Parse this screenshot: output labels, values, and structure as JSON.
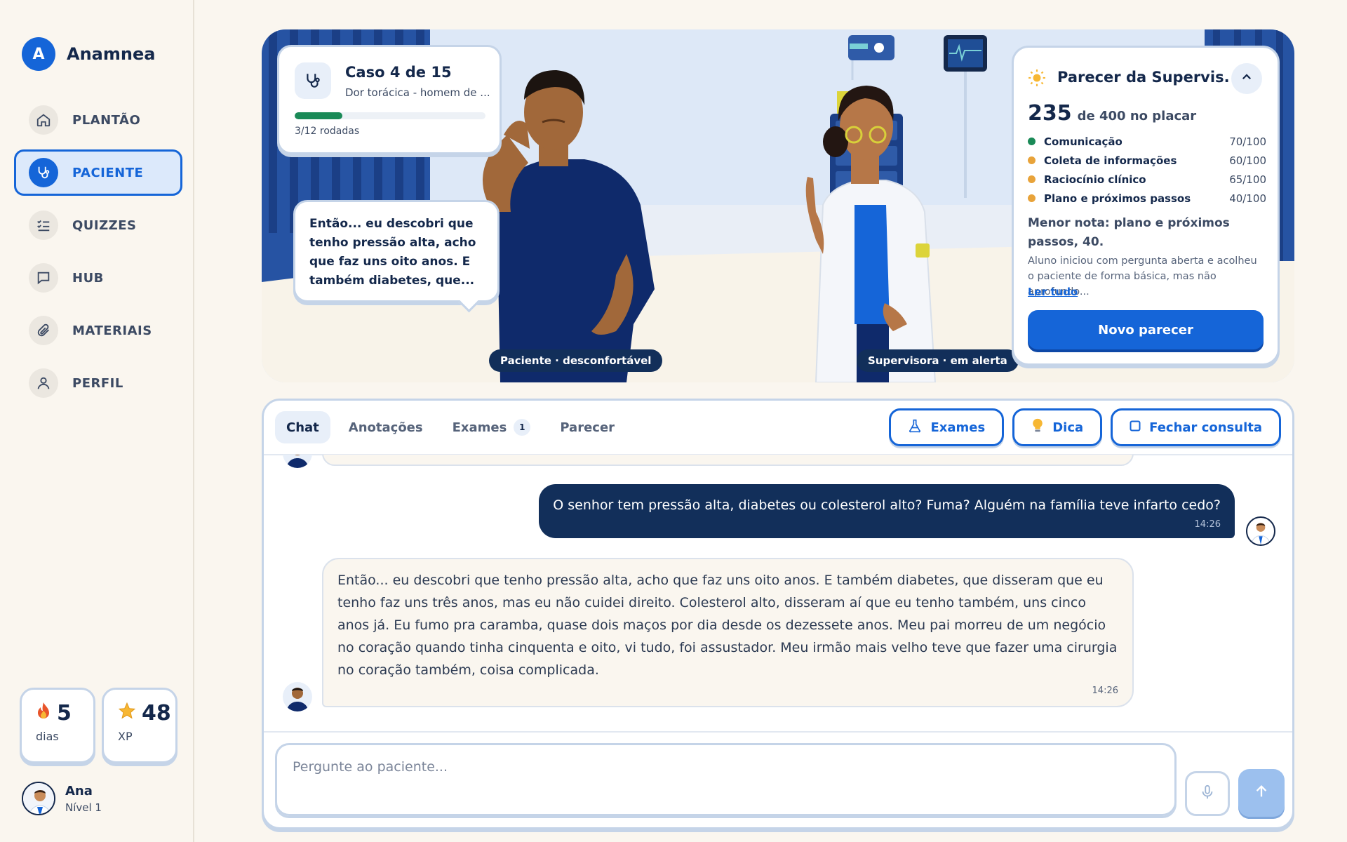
{
  "app": {
    "logo_letter": "A",
    "name": "Anamnea"
  },
  "sidebar": {
    "items": [
      {
        "label": "PLANTÃO",
        "icon": "home-icon"
      },
      {
        "label": "PACIENTE",
        "icon": "stethoscope-icon",
        "active": true
      },
      {
        "label": "QUIZZES",
        "icon": "checklist-icon"
      },
      {
        "label": "HUB",
        "icon": "chat-icon"
      },
      {
        "label": "MATERIAIS",
        "icon": "paperclip-icon"
      },
      {
        "label": "PERFIL",
        "icon": "user-icon"
      }
    ],
    "streak": {
      "value": "5",
      "label": "dias",
      "icon": "flame-icon"
    },
    "xp": {
      "value": "48",
      "label": "XP",
      "icon": "star-icon"
    },
    "user": {
      "name": "Ana",
      "level": "Nível 1"
    }
  },
  "case": {
    "title": "Caso 4 de 15",
    "subtitle": "Dor torácica - homem de ...",
    "progress_fraction": 0.25,
    "rounds": "3/12 rodadas"
  },
  "scene": {
    "speech": "Então... eu descobri que tenho pressão alta, acho que faz uns oito anos. E também diabetes, que...",
    "patient_tag": "Paciente · desconfortável",
    "supervisor_tag": "Supervisora · em alerta"
  },
  "supervision": {
    "title": "Parecer da Supervis...",
    "score": "235",
    "score_suffix": "de 400 no placar",
    "criteria": [
      {
        "name": "Comunicação",
        "value": "70/100",
        "color": "#1a8a57"
      },
      {
        "name": "Coleta de informações",
        "value": "60/100",
        "color": "#e8a33a"
      },
      {
        "name": "Raciocínio clínico",
        "value": "65/100",
        "color": "#e8a33a"
      },
      {
        "name": "Plano e próximos passos",
        "value": "40/100",
        "color": "#e8a33a"
      }
    ],
    "lowest": "Menor nota: plano e próximos passos, 40.",
    "summary": "Aluno iniciou com pergunta aberta e acolheu o paciente de forma básica, mas não aprofundo...",
    "read_all": "Ler tudo",
    "new_button": "Novo parecer"
  },
  "chat": {
    "tabs": [
      {
        "label": "Chat",
        "active": true
      },
      {
        "label": "Anotações"
      },
      {
        "label": "Exames",
        "badge": "1"
      },
      {
        "label": "Parecer"
      }
    ],
    "actions": {
      "exams": "Exames",
      "hint": "Dica",
      "close": "Fechar consulta"
    },
    "messages": [
      {
        "from": "student",
        "text": "O senhor tem pressão alta, diabetes ou colesterol alto? Fuma? Alguém na família teve infarto cedo?",
        "time": "14:26"
      },
      {
        "from": "patient",
        "text": "Então... eu descobri que tenho pressão alta, acho que faz uns oito anos. E também diabetes, que disseram que eu tenho faz uns três anos, mas eu não cuidei direito. Colesterol alto, disseram aí que eu tenho também, uns cinco anos já. Eu fumo pra caramba, quase dois maços por dia desde os dezessete anos. Meu pai morreu de um negócio no coração quando tinha cinquenta e oito, vi tudo, foi assustador. Meu irmão mais velho teve que fazer uma cirurgia no coração também, coisa complicada.",
        "time": "14:26"
      }
    ],
    "input_placeholder": "Pergunte ao paciente..."
  },
  "colors": {
    "accent": "#1565d8",
    "navy": "#122f5a",
    "background": "#faf6ef",
    "progress": "#1a8a57"
  }
}
